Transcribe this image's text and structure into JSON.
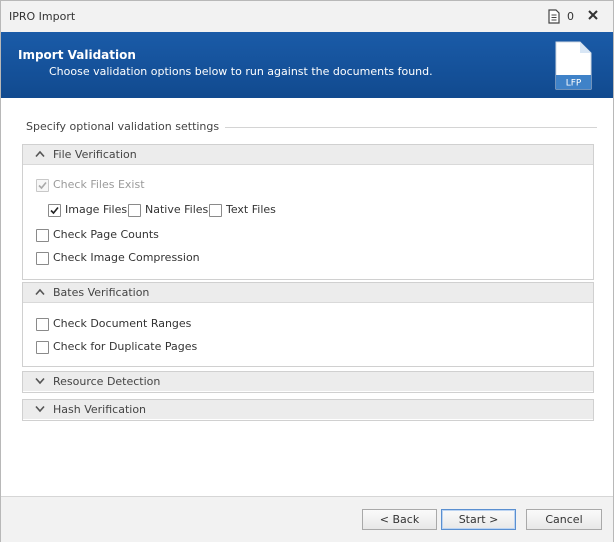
{
  "window": {
    "title": "IPRO Import",
    "doc_count": "0"
  },
  "banner": {
    "title": "Import Validation",
    "subtitle": "Choose validation options below to run against the documents found.",
    "icon_label": "LFP"
  },
  "group_label": "Specify optional validation settings",
  "sections": {
    "file_verification": {
      "title": "File Verification",
      "expanded": true,
      "check_files_exist": {
        "label": "Check Files Exist",
        "checked": true,
        "disabled": true
      },
      "image_files": {
        "label": "Image Files",
        "checked": true
      },
      "native_files": {
        "label": "Native Files",
        "checked": false
      },
      "text_files": {
        "label": "Text Files",
        "checked": false
      },
      "check_page_counts": {
        "label": "Check Page Counts",
        "checked": false
      },
      "check_image_compression": {
        "label": "Check Image Compression",
        "checked": false
      }
    },
    "bates_verification": {
      "title": "Bates Verification",
      "expanded": true,
      "check_document_ranges": {
        "label": "Check Document Ranges",
        "checked": false
      },
      "check_duplicate_pages": {
        "label": "Check for Duplicate Pages",
        "checked": false
      }
    },
    "resource_detection": {
      "title": "Resource Detection",
      "expanded": false
    },
    "hash_verification": {
      "title": "Hash Verification",
      "expanded": false
    }
  },
  "buttons": {
    "back": "< Back",
    "start": "Start >",
    "cancel": "Cancel"
  },
  "colors": {
    "banner": "#1a5ba8",
    "section_header": "#ececec",
    "primary_border": "#5a8fd0"
  }
}
